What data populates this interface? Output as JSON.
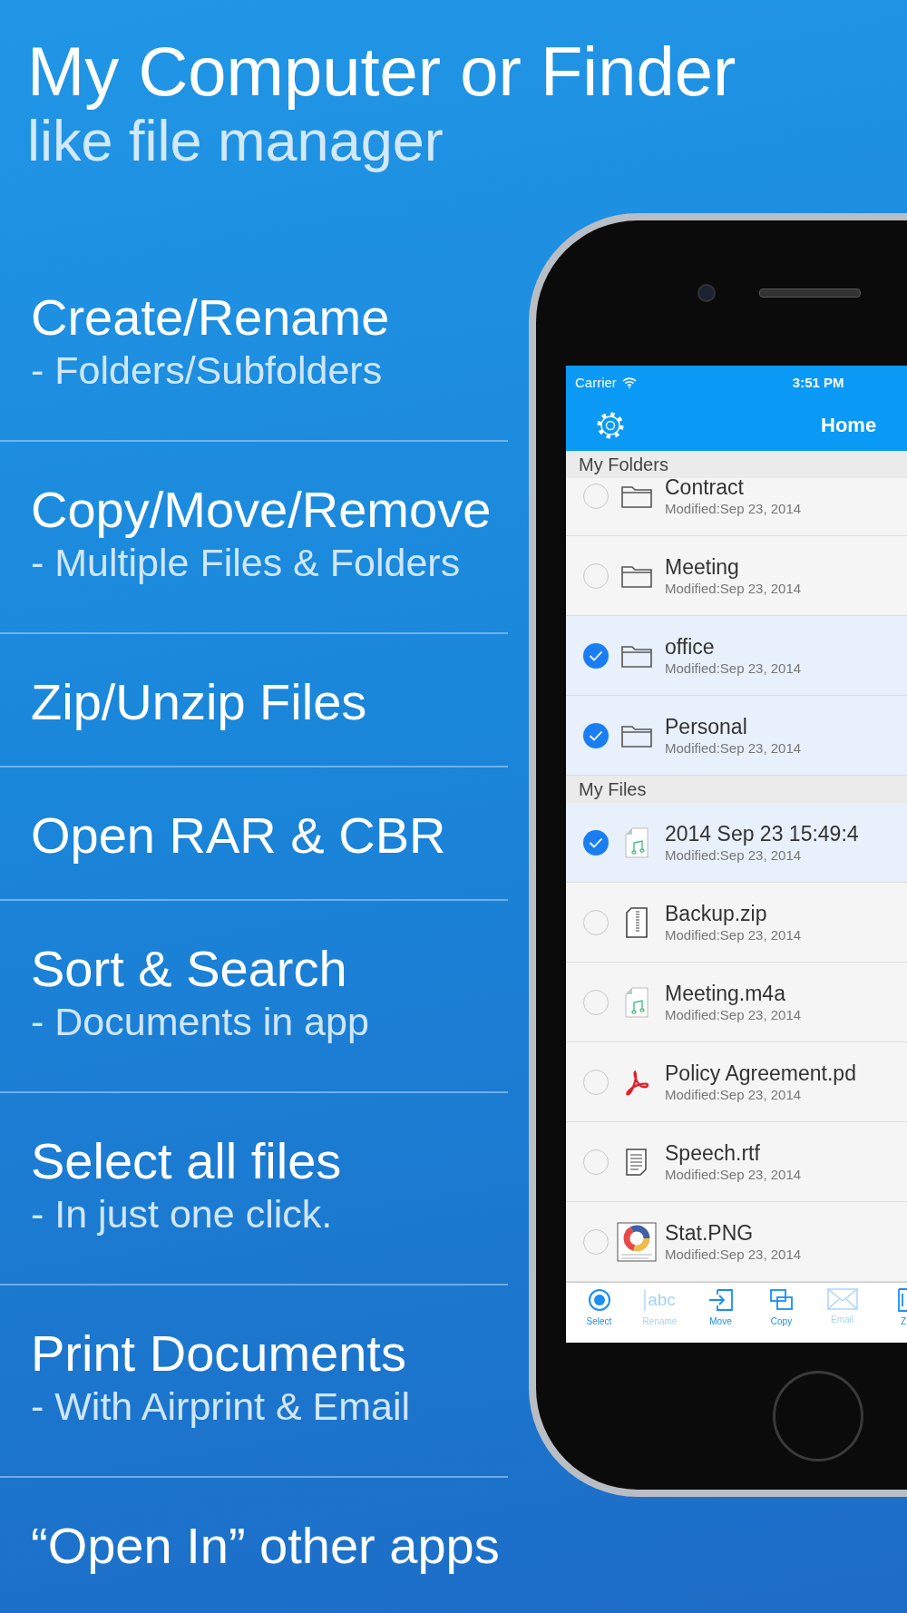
{
  "headline": {
    "title": "My Computer or Finder",
    "subtitle": "like file manager"
  },
  "features": [
    {
      "title": "Create/Rename",
      "subtitle": "- Folders/Subfolders"
    },
    {
      "title": "Copy/Move/Remove",
      "subtitle": "- Multiple Files & Folders"
    },
    {
      "title": "Zip/Unzip Files"
    },
    {
      "title": "Open RAR & CBR"
    },
    {
      "title": "Sort & Search",
      "subtitle": "- Documents in app"
    },
    {
      "title": "Select all files",
      "subtitle": "- In just one click."
    },
    {
      "title": "Print Documents",
      "subtitle": "- With Airprint & Email"
    },
    {
      "title": "“Open In” other apps"
    }
  ],
  "status_bar": {
    "carrier": "Carrier",
    "time": "3:51 PM"
  },
  "nav_bar": {
    "title": "Home"
  },
  "sections": [
    {
      "title": "My Folders",
      "items": [
        {
          "kind": "folder",
          "name": "Contract",
          "modified": "Modified:Sep 23, 2014",
          "selected": false
        },
        {
          "kind": "folder",
          "name": "Meeting",
          "modified": "Modified:Sep 23, 2014",
          "selected": false
        },
        {
          "kind": "folder",
          "name": "office",
          "modified": "Modified:Sep 23, 2014",
          "selected": true
        },
        {
          "kind": "folder",
          "name": "Personal",
          "modified": "Modified:Sep 23, 2014",
          "selected": true
        }
      ]
    },
    {
      "title": "My Files",
      "items": [
        {
          "kind": "audio",
          "name": "2014 Sep 23 15:49:4",
          "modified": "Modified:Sep 23, 2014",
          "selected": true
        },
        {
          "kind": "archive",
          "name": "Backup.zip",
          "modified": "Modified:Sep 23, 2014",
          "selected": false
        },
        {
          "kind": "audio",
          "name": "Meeting.m4a",
          "modified": "Modified:Sep 23, 2014",
          "selected": false
        },
        {
          "kind": "pdf",
          "name": "Policy Agreement.pd",
          "modified": "Modified:Sep 23, 2014",
          "selected": false
        },
        {
          "kind": "text",
          "name": "Speech.rtf",
          "modified": "Modified:Sep 23, 2014",
          "selected": false
        },
        {
          "kind": "image",
          "name": "Stat.PNG",
          "modified": "Modified:Sep 23, 2014",
          "selected": false
        }
      ]
    }
  ],
  "toolbar": [
    {
      "kind": "select",
      "label": "Select",
      "disabled": false
    },
    {
      "kind": "rename",
      "icon_text": "abc",
      "label": "Rename",
      "disabled": true
    },
    {
      "kind": "move",
      "label": "Move",
      "disabled": false
    },
    {
      "kind": "copy",
      "label": "Copy",
      "disabled": false
    },
    {
      "kind": "email",
      "label": "Email",
      "disabled": true
    },
    {
      "kind": "zip",
      "label": "Z",
      "disabled": false
    }
  ]
}
